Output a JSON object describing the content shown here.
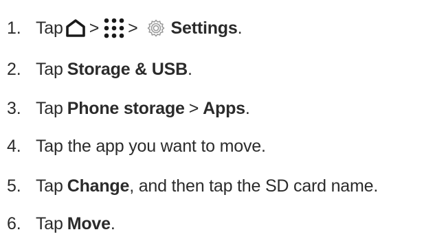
{
  "steps": [
    {
      "number": "1.",
      "parts": {
        "tap": "Tap",
        "sep1": ">",
        "sep2": ">",
        "settings": "Settings",
        "end": "."
      },
      "icons": [
        "home-icon",
        "apps-icon",
        "settings-gear-icon"
      ]
    },
    {
      "number": "2.",
      "parts": {
        "tap": "Tap",
        "bold": "Storage & USB",
        "end": "."
      }
    },
    {
      "number": "3.",
      "parts": {
        "tap": "Tap",
        "bold1": "Phone storage",
        "sep": ">",
        "bold2": "Apps",
        "end": "."
      }
    },
    {
      "number": "4.",
      "parts": {
        "text": "Tap the app you want to move."
      }
    },
    {
      "number": "5.",
      "parts": {
        "tap": "Tap",
        "bold": "Change",
        "rest": ", and then tap the SD card name."
      }
    },
    {
      "number": "6.",
      "parts": {
        "tap": "Tap",
        "bold": "Move",
        "end": "."
      }
    }
  ],
  "colors": {
    "text": "#2b2b2b",
    "icon_dark": "#1a1a1a",
    "icon_gear": "#9a9a9a"
  }
}
